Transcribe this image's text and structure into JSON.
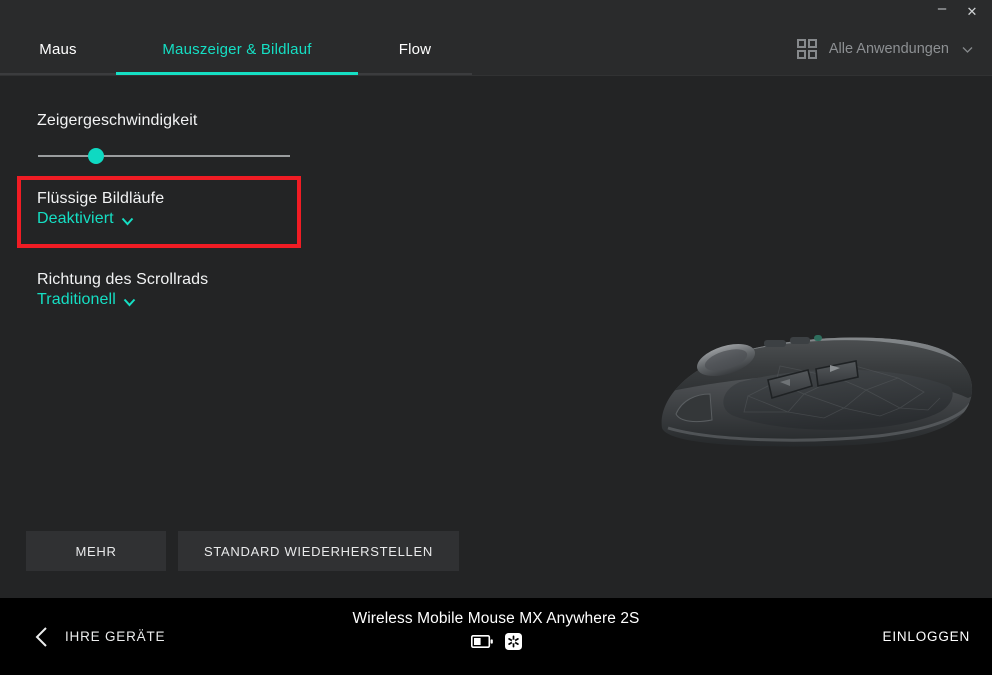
{
  "window": {
    "minimize_label": "–",
    "close_label": "✕"
  },
  "header": {
    "tabs": [
      {
        "label": "Maus",
        "active": false
      },
      {
        "label": "Mauszeiger & Bildlauf",
        "active": true
      },
      {
        "label": "Flow",
        "active": false
      }
    ],
    "app_filter": {
      "icon": "grid-icon",
      "label": "Alle Anwendungen",
      "chevron": "chevron-down-icon"
    },
    "accent_color": "#15dfc4"
  },
  "content": {
    "pointer_speed": {
      "title": "Zeigergeschwindigkeit",
      "slider": {
        "value_percent": 23,
        "min": 0,
        "max": 100
      }
    },
    "smooth_scrolling": {
      "title": "Flüssige Bildläufe",
      "value": "Deaktiviert",
      "highlighted": true,
      "highlight_color": "#f01c24"
    },
    "scroll_direction": {
      "title": "Richtung des Scrollrads",
      "value": "Traditionell"
    },
    "buttons": [
      {
        "label": "MEHR"
      },
      {
        "label": "STANDARD WIEDERHERSTELLEN"
      }
    ],
    "device_image": "mx-anywhere-2s-mouse"
  },
  "footer": {
    "back_label": "IHRE GERÄTE",
    "back_icon": "chevron-left-icon",
    "device_name": "Wireless Mobile Mouse MX Anywhere 2S",
    "battery_icon": "battery-half-icon",
    "unifying_icon": "unifying-receiver-icon",
    "login_label": "EINLOGGEN"
  }
}
